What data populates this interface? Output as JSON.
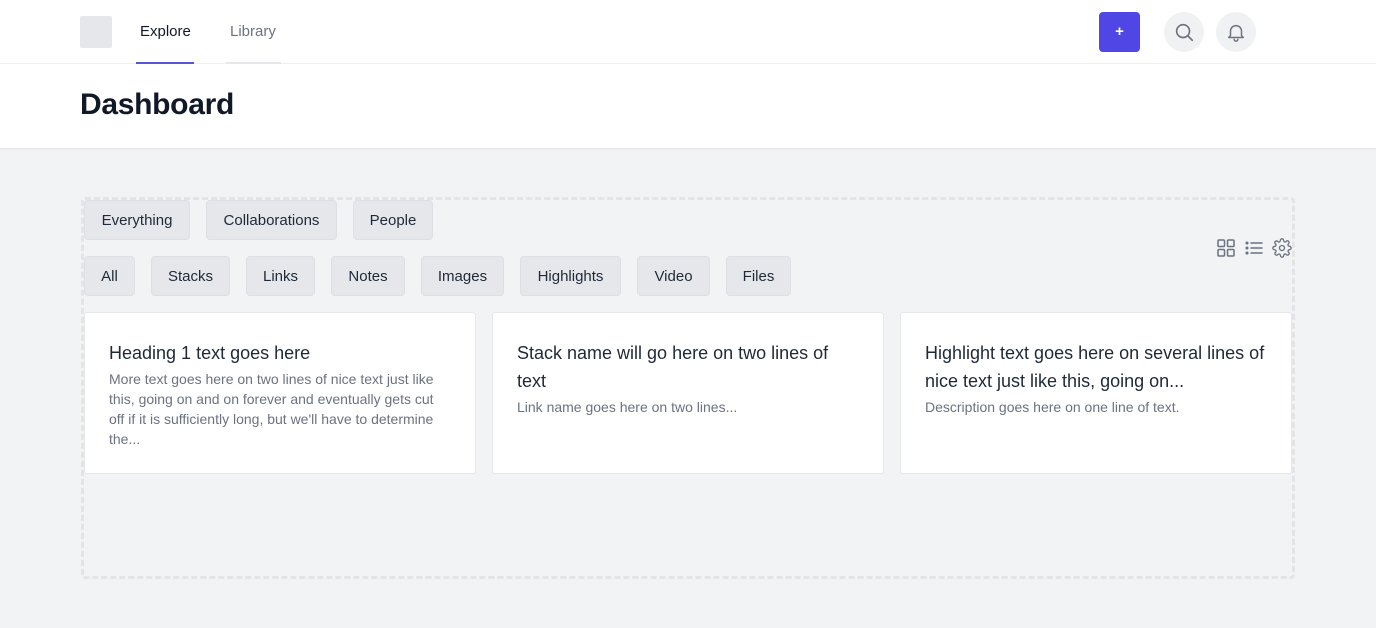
{
  "nav": {
    "tabs": [
      {
        "label": "Explore",
        "active": true
      },
      {
        "label": "Library",
        "active": false
      }
    ],
    "add_label": "+",
    "icons": {
      "search": "search-icon",
      "notifications": "bell-icon",
      "logo": "logo-placeholder"
    }
  },
  "header": {
    "title": "Dashboard"
  },
  "filters": {
    "scope": [
      "Everything",
      "Collaborations",
      "People"
    ],
    "types": [
      "All",
      "Stacks",
      "Links",
      "Notes",
      "Images",
      "Highlights",
      "Video",
      "Files"
    ]
  },
  "view_controls": {
    "icons": [
      "grid-icon",
      "list-icon",
      "gear-icon"
    ]
  },
  "cards": [
    {
      "title": "Heading 1 text goes here",
      "description": "More text goes here on two lines of nice text just like this, going on and on forever and eventually gets cut off if it is sufficiently long, but we'll have to determine the..."
    },
    {
      "title": "Stack name will go here on two lines of text",
      "description": "Link name goes here on two lines..."
    },
    {
      "title": "Highlight text goes here on several lines of nice text just like this, going on...",
      "description": "Description goes here on one line of text."
    }
  ],
  "colors": {
    "accent": "#4f46e5",
    "tab_underline": "#5b54d6",
    "background": "#f2f3f5"
  }
}
